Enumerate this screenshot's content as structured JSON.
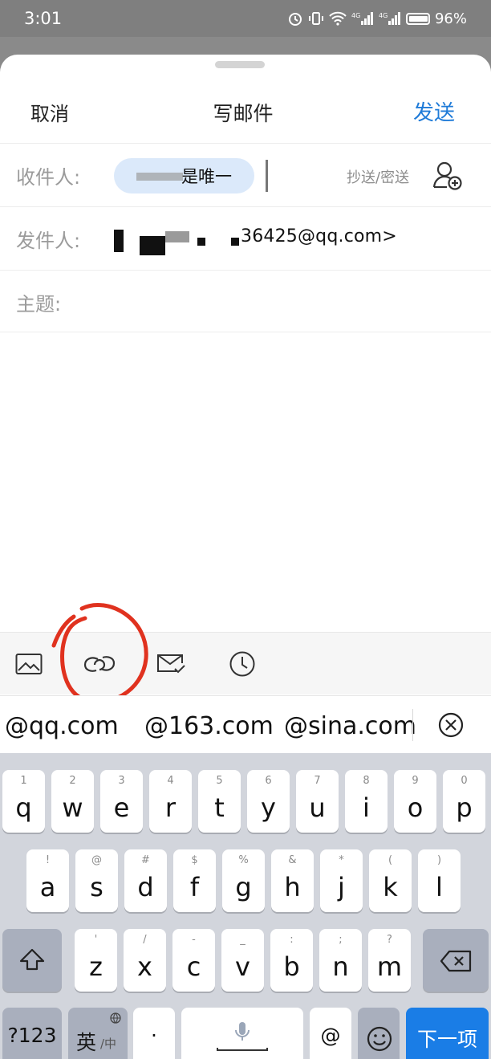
{
  "status": {
    "time": "3:01",
    "net1": "4G",
    "net2": "4G",
    "battery": "96%"
  },
  "nav": {
    "cancel": "取消",
    "title": "写邮件",
    "send": "发送"
  },
  "compose": {
    "to_label": "收件人:",
    "to_chip": "是唯一",
    "cc_bcc": "抄送/密送",
    "from_label": "发件人:",
    "from_value": "36425@qq.com>",
    "subject_label": "主题:"
  },
  "toolbar": {
    "icons": [
      "image-icon",
      "link-icon",
      "mail-check-icon",
      "clock-icon"
    ]
  },
  "suggestions": [
    "@qq.com",
    "@163.com",
    "@sina.com"
  ],
  "keyboard": {
    "row1": [
      {
        "k": "q",
        "n": "1"
      },
      {
        "k": "w",
        "n": "2"
      },
      {
        "k": "e",
        "n": "3"
      },
      {
        "k": "r",
        "n": "4"
      },
      {
        "k": "t",
        "n": "5"
      },
      {
        "k": "y",
        "n": "6"
      },
      {
        "k": "u",
        "n": "7"
      },
      {
        "k": "i",
        "n": "8"
      },
      {
        "k": "o",
        "n": "9"
      },
      {
        "k": "p",
        "n": "0"
      }
    ],
    "row2": [
      {
        "k": "a",
        "n": "!"
      },
      {
        "k": "s",
        "n": "@"
      },
      {
        "k": "d",
        "n": "#"
      },
      {
        "k": "f",
        "n": "$"
      },
      {
        "k": "g",
        "n": "%"
      },
      {
        "k": "h",
        "n": "&"
      },
      {
        "k": "j",
        "n": "*"
      },
      {
        "k": "k",
        "n": "("
      },
      {
        "k": "l",
        "n": ")"
      }
    ],
    "row3": [
      {
        "k": "z",
        "n": "'"
      },
      {
        "k": "x",
        "n": "/"
      },
      {
        "k": "c",
        "n": "-"
      },
      {
        "k": "v",
        "n": "_"
      },
      {
        "k": "b",
        "n": ":"
      },
      {
        "k": "n",
        "n": ";"
      },
      {
        "k": "m",
        "n": "?"
      }
    ],
    "symbols_key": "?123",
    "lang_key": "英",
    "lang_key_sub": "/中",
    "dot_key": "·",
    "at_key": "@",
    "next_key": "下一项"
  },
  "colors": {
    "accent": "#1f7bd8",
    "chip": "#dbe9fa",
    "annotation": "#e0321f",
    "next_key": "#1a7de6"
  }
}
